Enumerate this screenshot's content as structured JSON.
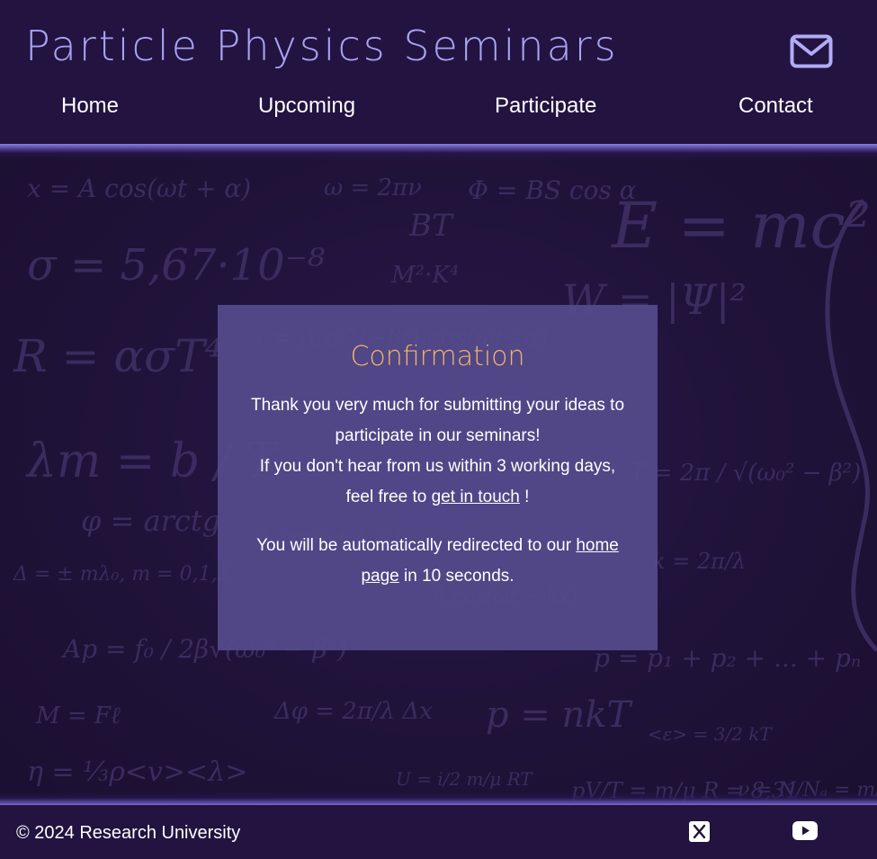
{
  "header": {
    "site_title": "Particle Physics Seminars",
    "mail_icon": "envelope-icon",
    "nav": [
      {
        "label": "Home"
      },
      {
        "label": "Upcoming"
      },
      {
        "label": "Participate"
      },
      {
        "label": "Contact"
      }
    ]
  },
  "background": {
    "formulas": [
      "x = A cos(ωt + α)",
      "ω = 2πν",
      "Φ = BS cos α",
      "E = mc²",
      "σ = 5,67·10⁻⁸",
      "BT",
      "W = |Ψ|²",
      "R = ασT⁴",
      "M²·K⁴",
      "λm = b / T",
      "φ = arctg",
      "Δ = ± mλ₀, m = 0,1,2",
      "Ap = f₀ / 2β√(ω₀² − β²)",
      "M = Fℓ",
      "Δφ = 2π/λ Δx",
      "p = nkT",
      "η = ⅓ρ<v><λ>",
      "<ε> = 3/2 kT",
      "U = i/2 m/μ RT",
      "pV/T = m/μ R = 8,31",
      "ν = N/Nₐ = m/μ",
      "x = A₀e^(−βt) cos(ωt+α)",
      "T = 2π / √(ω₀² − β²)",
      "k = 2π/λ",
      "A cos(ωt − kx)",
      "p = p₁ + p₂ + ... + pₙ",
      "Aᵢ cos(ωt + φᵢ)"
    ]
  },
  "card": {
    "title": "Confirmation",
    "line1": "Thank you very much for submitting your ideas to participate in our seminars!",
    "line2_before": "If you don't hear from us within 3 working days, feel free to",
    "line2_link": "get in touch",
    "line2_after": "!",
    "redirect_before": "You will be automatically redirected to our",
    "redirect_link": "home page",
    "redirect_after": "in 10 seconds."
  },
  "footer": {
    "copyright": "© 2024 Research University",
    "social": [
      {
        "icon": "x-twitter-icon"
      },
      {
        "icon": "youtube-icon"
      }
    ]
  },
  "colors": {
    "background": "#1f1238",
    "title": "#a9a3f3",
    "card": "#554a8c",
    "heading_accent": "#f2b56b",
    "glow": "#8a80dd"
  }
}
